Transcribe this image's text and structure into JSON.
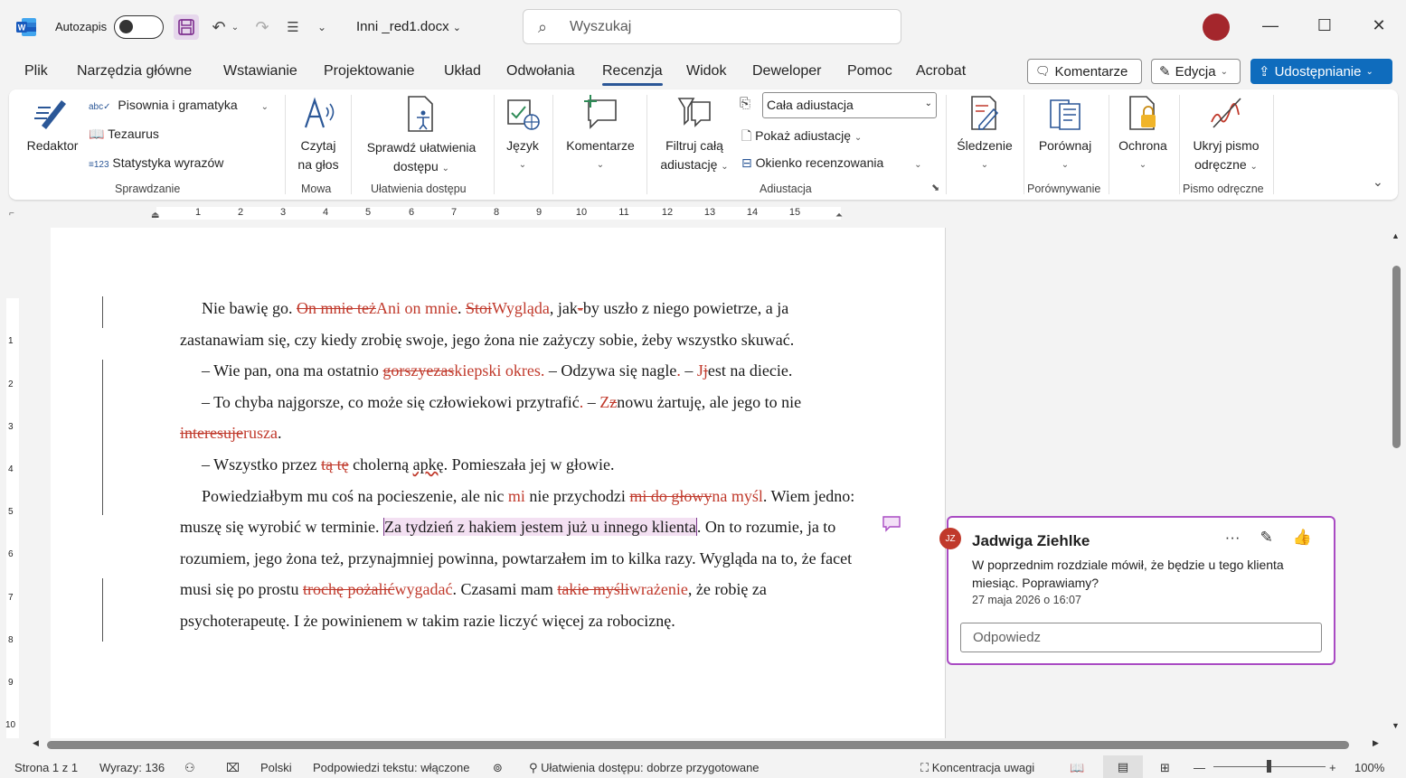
{
  "titlebar": {
    "autosave_label": "Autozapis",
    "document_name": "Inni _red1.docx",
    "search_placeholder": "Wyszukaj"
  },
  "menu": {
    "tabs": [
      "Plik",
      "Narzędzia główne",
      "Wstawianie",
      "Projektowanie",
      "Układ",
      "Odwołania",
      "Recenzja",
      "Widok",
      "Deweloper",
      "Pomoc",
      "Acrobat"
    ],
    "active_tab": "Recenzja",
    "comments_button": "Komentarze",
    "editing_button": "Edycja",
    "share_button": "Udostępnianie"
  },
  "ribbon": {
    "editor": "Redaktor",
    "spelling": "Pisownia i gramatyka",
    "thesaurus": "Tezaurus",
    "word_count": "Statystyka wyrazów",
    "group_proofing": "Sprawdzanie",
    "read_aloud_1": "Czytaj",
    "read_aloud_2": "na głos",
    "group_speech": "Mowa",
    "accessibility_1": "Sprawdź ułatwienia",
    "accessibility_2": "dostępu",
    "group_accessibility": "Ułatwienia dostępu",
    "language": "Język",
    "comments": "Komentarze",
    "filter_1": "Filtruj całą",
    "filter_2": "adiustację",
    "markup_combo": "Cała adiustacja",
    "show_markup": "Pokaż adiustację",
    "reviewing_pane": "Okienko recenzowania",
    "group_tracking": "Adiustacja",
    "track_changes": "Śledzenie",
    "compare": "Porównaj",
    "group_compare": "Porównywanie",
    "protect": "Ochrona",
    "hide_ink_1": "Ukryj pismo",
    "hide_ink_2": "odręczne",
    "group_ink": "Pismo odręczne"
  },
  "ruler": {
    "labels": [
      "1",
      "2",
      "3",
      "4",
      "5",
      "6",
      "7",
      "8",
      "9",
      "10",
      "11",
      "12",
      "13",
      "14",
      "15"
    ],
    "vlabels": [
      "1",
      "2",
      "3",
      "4",
      "5",
      "6",
      "7",
      "8",
      "9",
      "10"
    ]
  },
  "document": {
    "p1": {
      "a": "Nie bawię go. ",
      "b_del": "On mnie też",
      "c_ins": "Ani on mnie",
      "d": ". ",
      "e_del": "Stoi",
      "f_ins": "Wygląda",
      "g": ", jak",
      "h_del": "-",
      "i": "by uszło z niego powietrze, a ja zastanawiam się, czy kiedy zrobię swoje, jego żona nie zażyczy sobie, żeby wszystko skuwać."
    },
    "p2": {
      "a": "– Wie pan, ona ma ostatnio ",
      "b_del": "gorszy",
      "c_del2": "ezas",
      "d_ins": "kiepski okres",
      "e_ins": ".",
      "f": " – Odzywa się nagle",
      "g_ins": ".",
      "h": " – ",
      "i_ins": "J",
      "j_del": "j",
      "k": "est na diecie."
    },
    "p3": {
      "a": "– To chyba najgorsze, co może się człowiekowi przytrafić",
      "b_ins": ".",
      "c": " – ",
      "d_ins": "Z",
      "e_del": "z",
      "f": "nowu żartuję, ale jego to nie ",
      "g_del": "interesuje",
      "h_ins": "rusza",
      "i": "."
    },
    "p4": {
      "a": "– Wszystko przez ",
      "b_del": "tą tę",
      "c": " cholerną ",
      "d_spell": "apkę",
      "e": ". Pomieszała jej w głowie."
    },
    "p5": {
      "a": "Powiedziałbym mu coś na pocieszenie, ale nic ",
      "b_ins": "mi",
      "c": " nie przychodzi ",
      "d_del": "mi do głowy",
      "e_ins": "na myśl",
      "f": ". Wiem jedno: muszę się wyrobić w terminie. ",
      "g_hl": "Za tydzień z hakiem jestem już u innego klienta",
      "h": ". On to rozumie, ja to rozumiem, jego żona też, przynajmniej powinna, powtarzałem im to kilka razy. Wygląda na to, że facet musi się po prostu ",
      "i_del": "trochę pożalić",
      "j_ins": "wygadać",
      "k": ". Czasami mam ",
      "l_del": "takie myśli",
      "m_ins": "wrażenie",
      "n": ", że robię za psychoterapeutę. I że powinienem w takim razie liczyć więcej za robociznę."
    }
  },
  "comment": {
    "initials": "JZ",
    "author": "Jadwiga Ziehlke",
    "text": "W poprzednim rozdziale mówił, że będzie u tego klienta miesiąc. Poprawiamy?",
    "date": "27 maja 2026 o 16:07",
    "reply_placeholder": "Odpowiedz"
  },
  "statusbar": {
    "page": "Strona 1 z 1",
    "words": "Wyrazy: 136",
    "language": "Polski",
    "predictions": "Podpowiedzi tekstu: włączone",
    "accessibility": "Ułatwienia dostępu: dobrze przygotowane",
    "focus": "Koncentracja uwagi",
    "zoom": "100%"
  },
  "colors": {
    "accent": "#0f6cbd",
    "revision": "#c0392b",
    "comment": "#a94bc3"
  }
}
